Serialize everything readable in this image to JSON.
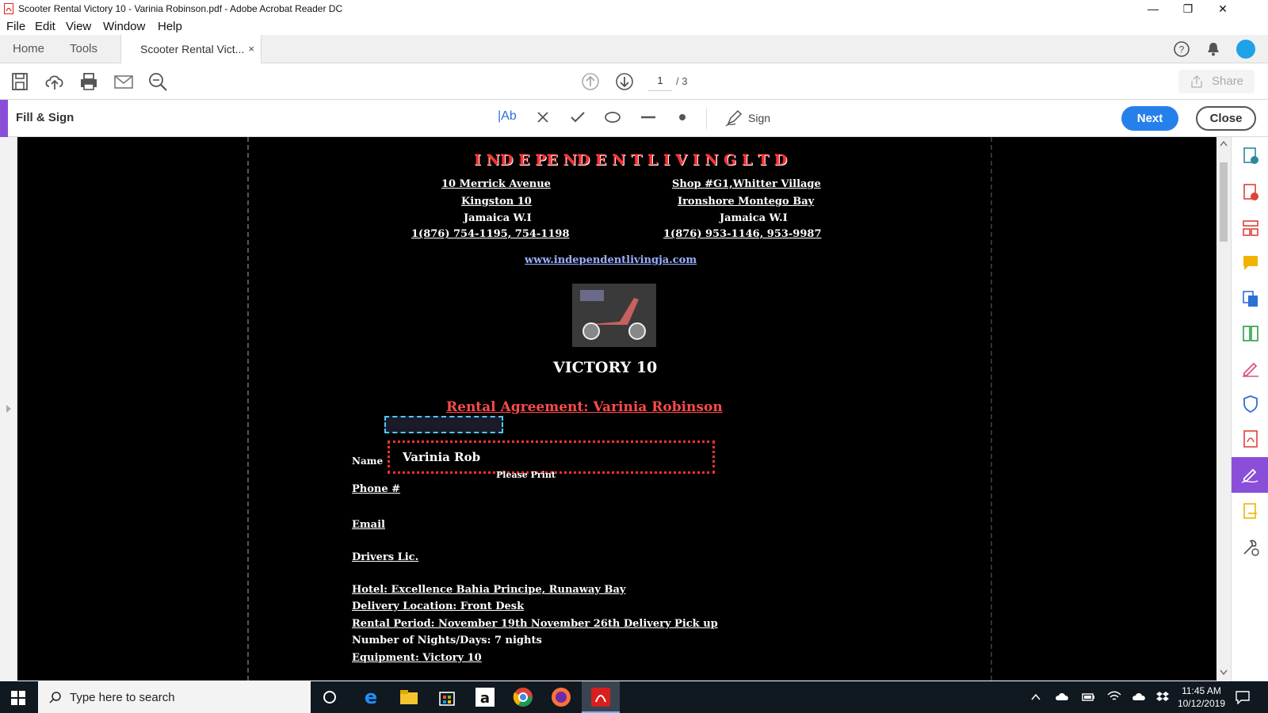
{
  "window": {
    "title": "Scooter Rental  Victory 10 - Varinia Robinson.pdf - Adobe Acrobat Reader DC",
    "controls": [
      "—",
      "❐",
      "✕"
    ]
  },
  "menu": [
    "File",
    "Edit",
    "View",
    "Window",
    "Help"
  ],
  "tabs": {
    "home": "Home",
    "tools": "Tools",
    "document": "Scooter Rental  Vict...",
    "close": "×"
  },
  "toolbar": {
    "page_current": "1",
    "page_total": "/ 3",
    "share": "Share"
  },
  "fill_sign": {
    "label": "Fill & Sign",
    "text_tool": "|Ab",
    "sign": "Sign",
    "next": "Next",
    "close": "Close"
  },
  "document": {
    "company": "I ND E PE ND E N T  L I V I N G  L T D",
    "addr_left": [
      "10 Merrick Avenue",
      "Kingston 10",
      "Jamaica W.I",
      "1(876) 754-1195, 754-1198"
    ],
    "addr_right": [
      "Shop #G1,Whitter Village",
      "Ironshore Montego Bay",
      "Jamaica W.I",
      "1(876) 953-1146, 953-9987"
    ],
    "website": "www.independentlivingja.com",
    "model": "VICTORY 10",
    "agreement": "Rental Agreement:  Varinia Robinson",
    "name_label": "Name",
    "name_value": "Varinia Rob",
    "please_print": "Please Print",
    "phone_label": "Phone #",
    "email_label": "Email",
    "drivers_label": "Drivers Lic.",
    "hotel_line": "Hotel: Excellence Bahia Principe, Runaway Bay",
    "delivery_line": "Delivery Location: Front Desk",
    "rental_line": "Rental Period: November 19th    November 26th  Delivery  Pick up",
    "nights_line": "Number of Nights/Days: 7 nights",
    "equipment_line": "Equipment: Victory 10"
  },
  "taskbar": {
    "search_placeholder": "Type here to search",
    "time": "11:45 AM",
    "date": "10/12/2019"
  },
  "colors": {
    "accent": "#2680eb",
    "fill_sign_stripe": "#8a4fd8"
  }
}
